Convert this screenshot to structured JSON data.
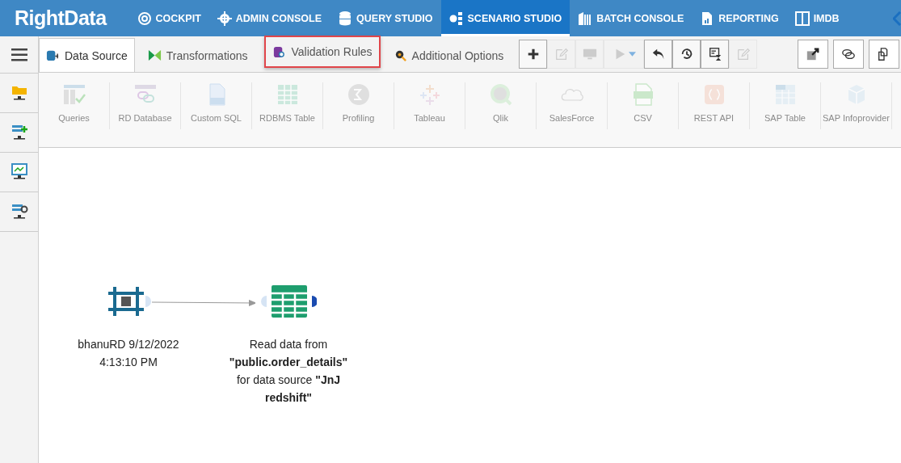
{
  "brand": {
    "logo": "RightData"
  },
  "nav": [
    {
      "label": "COCKPIT",
      "selected": false
    },
    {
      "label": "ADMIN CONSOLE",
      "selected": false
    },
    {
      "label": "QUERY STUDIO",
      "selected": false
    },
    {
      "label": "SCENARIO STUDIO",
      "selected": true
    },
    {
      "label": "BATCH CONSOLE",
      "selected": false
    },
    {
      "label": "REPORTING",
      "selected": false
    },
    {
      "label": "IMDB",
      "selected": false
    }
  ],
  "tabs": [
    {
      "label": "Data Source",
      "selected": true,
      "highlighted": false
    },
    {
      "label": "Transformations",
      "selected": false,
      "highlighted": false
    },
    {
      "label": "Validation Rules",
      "selected": false,
      "highlighted": true
    },
    {
      "label": "Additional Options",
      "selected": false,
      "highlighted": false
    }
  ],
  "toolbar": [
    {
      "kind": "add",
      "disabled": false
    },
    {
      "kind": "edit",
      "disabled": true
    },
    {
      "kind": "monitor",
      "disabled": true
    },
    {
      "kind": "run",
      "disabled": true
    },
    {
      "kind": "undo",
      "disabled": false
    },
    {
      "kind": "history",
      "disabled": false
    },
    {
      "kind": "schedule",
      "disabled": false
    },
    {
      "kind": "edit",
      "disabled": true
    }
  ],
  "toolbar_right": [
    {
      "kind": "popout",
      "disabled": false
    },
    {
      "kind": "comments",
      "disabled": false
    },
    {
      "kind": "copy",
      "disabled": false
    }
  ],
  "ribbon": [
    {
      "label": "Queries",
      "disabled": true
    },
    {
      "label": "RD Database",
      "disabled": true
    },
    {
      "label": "Custom SQL",
      "disabled": true
    },
    {
      "label": "RDBMS Table",
      "disabled": true
    },
    {
      "label": "Profiling",
      "disabled": true
    },
    {
      "label": "Tableau",
      "disabled": true
    },
    {
      "label": "Qlik",
      "disabled": true
    },
    {
      "label": "SalesForce",
      "disabled": true
    },
    {
      "label": "CSV",
      "disabled": true
    },
    {
      "label": "REST API",
      "disabled": true
    },
    {
      "label": "SAP Table",
      "disabled": true
    },
    {
      "label": "SAP Infoprovider",
      "disabled": true
    }
  ],
  "canvas": {
    "nodes": [
      {
        "kind": "start",
        "label": "bhanuRD 9/12/2022 4:13:10 PM"
      },
      {
        "kind": "table",
        "label": "Read data from **\"public.order_details\"** for data source **\"JnJ redshift\"**"
      }
    ]
  }
}
